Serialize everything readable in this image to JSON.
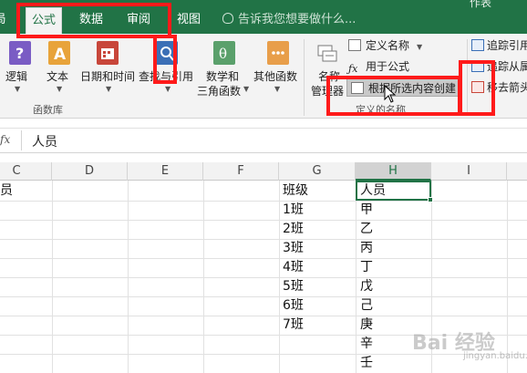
{
  "ribbon_tabs": [
    {
      "label": "局"
    },
    {
      "label": "公式"
    },
    {
      "label": "数据"
    },
    {
      "label": "审阅"
    },
    {
      "label": "视图"
    }
  ],
  "tell_me": "告诉我您想要做什么...",
  "top_right_fragment": "作表",
  "groups": {
    "function_library": {
      "label": "函数库",
      "buttons": [
        {
          "label": "逻辑"
        },
        {
          "label": "文本"
        },
        {
          "label": "日期和时间"
        },
        {
          "label": "查找与引用"
        },
        {
          "label_line1": "数学和",
          "label_line2": "三角函数"
        },
        {
          "label": "其他函数"
        }
      ]
    },
    "defined_names": {
      "label": "定义的名称",
      "name_manager_line1": "名称",
      "name_manager_line2": "管理器",
      "define_name": "定义名称",
      "use_in_formula": "用于公式",
      "create_from_selection": "根据所选内容创建"
    },
    "formula_auditing": {
      "trace_precedents": "追踪引用",
      "trace_dependents": "追踪从属",
      "remove_arrows": "移去箭头"
    }
  },
  "formula_bar": {
    "fx": "fx",
    "value": "人员"
  },
  "columns": [
    "C",
    "D",
    "E",
    "F",
    "G",
    "H",
    "I"
  ],
  "selected_column": "H",
  "column_g": [
    "班级",
    "1班",
    "2班",
    "3班",
    "4班",
    "5班",
    "6班",
    "7班"
  ],
  "column_h": [
    "人员",
    "甲",
    "乙",
    "丙",
    "丁",
    "戊",
    "己",
    "庚",
    "辛",
    "壬"
  ],
  "left_fragment": "员",
  "watermark": "Bai 经验",
  "watermark_sub": "jingyan.baidu.com",
  "colors": {
    "ribbon_green": "#217346",
    "annotation_red": "#ff1a1a"
  }
}
